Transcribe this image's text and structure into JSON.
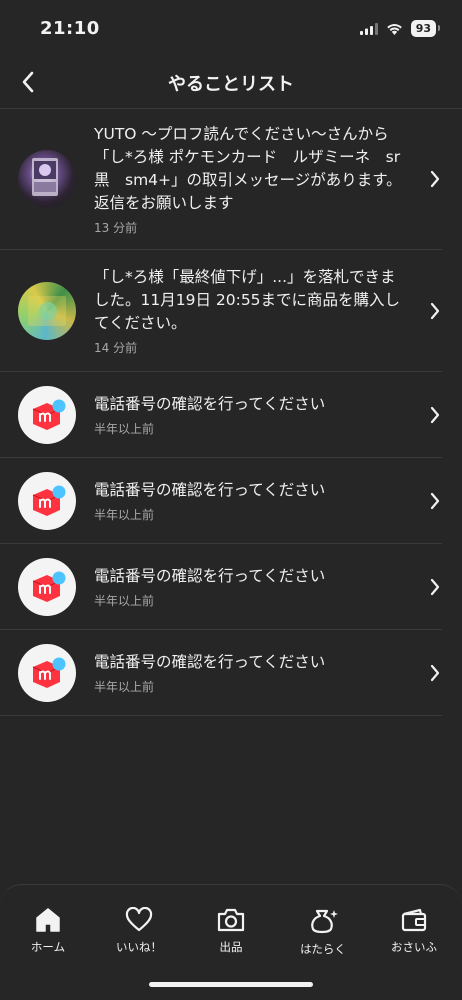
{
  "status_bar": {
    "time": "21:10",
    "battery": "93"
  },
  "header": {
    "title": "やることリスト"
  },
  "todo_items": [
    {
      "message": "YUTO 〜プロフ読んでください〜さんから「し*ろ様 ポケモンカード　ルザミーネ　sr 黒　sm4+」の取引メッセージがあります。返信をお願いします",
      "time": "13 分前"
    },
    {
      "message": "「し*ろ様「最終値下げ」...」を落札できました。11月19日 20:55までに商品を購入してください。",
      "time": "14 分前"
    },
    {
      "message": "電話番号の確認を行ってください",
      "time": "半年以上前"
    },
    {
      "message": "電話番号の確認を行ってください",
      "time": "半年以上前"
    },
    {
      "message": "電話番号の確認を行ってください",
      "time": "半年以上前"
    },
    {
      "message": "電話番号の確認を行ってください",
      "time": "半年以上前"
    }
  ],
  "tab_bar": {
    "items": [
      {
        "label": "ホーム",
        "icon": "home-icon"
      },
      {
        "label": "いいね！",
        "icon": "heart-icon"
      },
      {
        "label": "出品",
        "icon": "camera-icon"
      },
      {
        "label": "はたらく",
        "icon": "money-bag-icon"
      },
      {
        "label": "おさいふ",
        "icon": "wallet-icon"
      }
    ]
  },
  "colors": {
    "background": "#262626",
    "mercari_red": "#ff333f",
    "mercari_blue": "#4dc3ff"
  }
}
